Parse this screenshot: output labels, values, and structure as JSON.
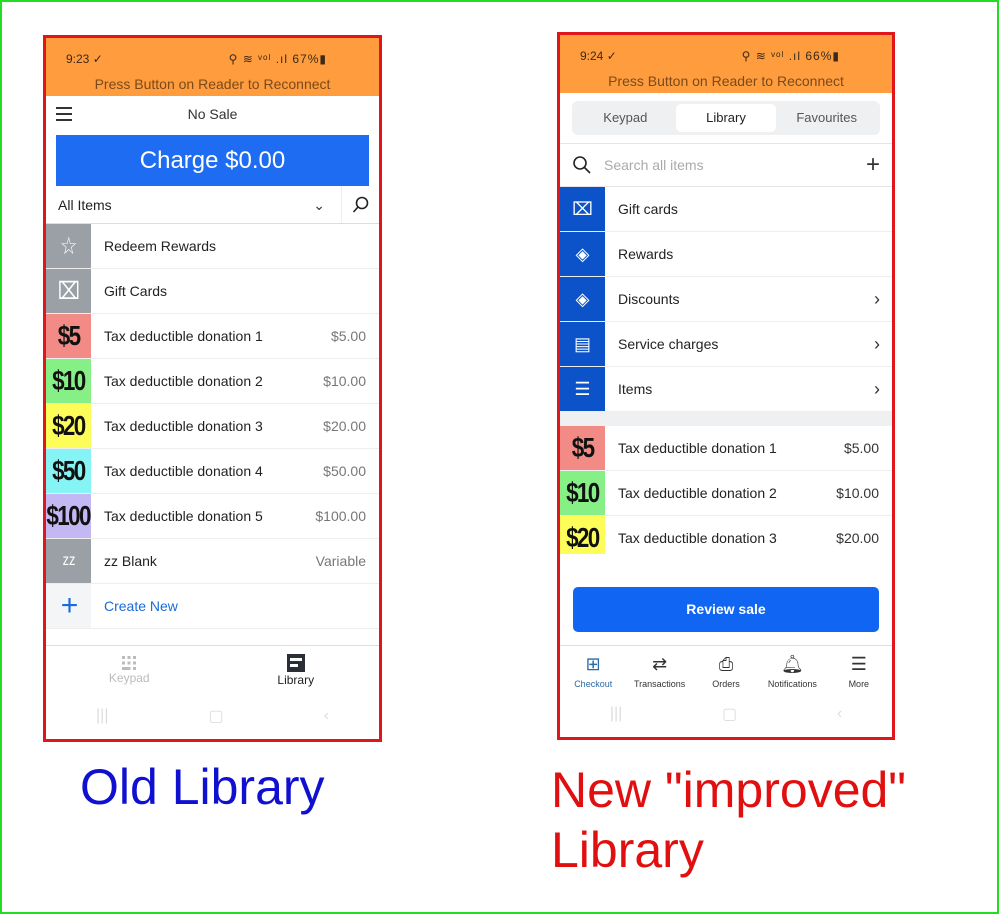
{
  "old": {
    "status": {
      "time": "9:23 ✓",
      "icons": "⚲ ≋ ᵛᵒˡ .ıl 67%▮",
      "banner": "Press Button on Reader to Reconnect"
    },
    "header_title": "No Sale",
    "charge_label": "Charge $0.00",
    "filter_label": "All Items",
    "items": [
      {
        "tile": "☆",
        "label": "Redeem Rewards",
        "price": ""
      },
      {
        "tile": "⌧",
        "label": "Gift Cards",
        "price": ""
      },
      {
        "tile": "$5",
        "label": "Tax deductible donation 1",
        "price": "$5.00",
        "color": "#f28b86"
      },
      {
        "tile": "$10",
        "label": "Tax deductible donation 2",
        "price": "$10.00",
        "color": "#86ef86"
      },
      {
        "tile": "$20",
        "label": "Tax deductible donation 3",
        "price": "$20.00",
        "color": "#fdfd5a"
      },
      {
        "tile": "$50",
        "label": "Tax deductible donation 4",
        "price": "$50.00",
        "color": "#86f4f4"
      },
      {
        "tile": "$100",
        "label": "Tax deductible donation 5",
        "price": "$100.00",
        "color": "#c3b8f4"
      },
      {
        "tile": "zz",
        "label": "zz Blank",
        "price": "Variable"
      }
    ],
    "create_label": "Create New",
    "tabs": [
      {
        "label": "Keypad"
      },
      {
        "label": "Library"
      }
    ]
  },
  "new": {
    "status": {
      "time": "9:24 ✓",
      "icons": "⚲ ≋ ᵛᵒˡ .ıl 66%▮",
      "banner": "Press Button on Reader to Reconnect"
    },
    "segments": [
      "Keypad",
      "Library",
      "Favourites"
    ],
    "search_placeholder": "Search all items",
    "categories": [
      {
        "label": "Gift cards",
        "chevron": false
      },
      {
        "label": "Rewards",
        "chevron": false
      },
      {
        "label": "Discounts",
        "chevron": true
      },
      {
        "label": "Service charges",
        "chevron": true
      },
      {
        "label": "Items",
        "chevron": true
      }
    ],
    "items": [
      {
        "tile": "$5",
        "label": "Tax deductible donation 1",
        "price": "$5.00",
        "color": "#f28b86"
      },
      {
        "tile": "$10",
        "label": "Tax deductible donation 2",
        "price": "$10.00",
        "color": "#86ef86"
      },
      {
        "tile": "$20",
        "label": "Tax deductible donation 3",
        "price": "$20.00",
        "color": "#fdfd5a"
      }
    ],
    "review_label": "Review sale",
    "tabs": [
      "Checkout",
      "Transactions",
      "Orders",
      "Notifications",
      "More"
    ]
  },
  "captions": {
    "old": "Old Library",
    "new_line1": "New \"improved\"",
    "new_line2": "Library"
  }
}
